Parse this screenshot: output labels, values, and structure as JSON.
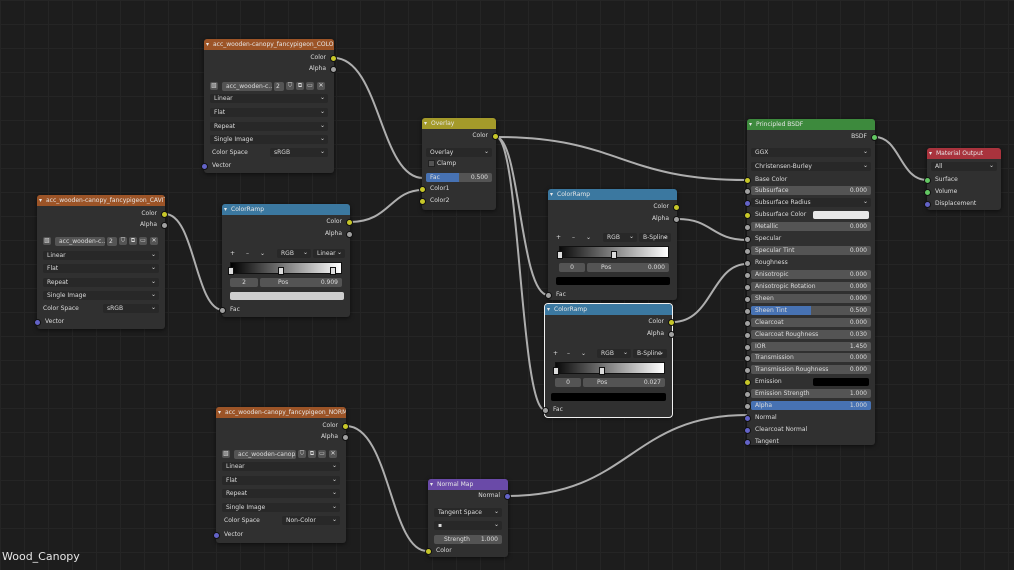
{
  "editor_label": "Wood_Canopy",
  "colors": {
    "texture_header": "#9c5427",
    "converter_header": "#3b78a0",
    "shader_header": "#3d8a3d",
    "output_header": "#a9333d",
    "color_header": "#a49a2a",
    "vector_header": "#6a4aa8",
    "socket_color": "#c7c729",
    "socket_float": "#a1a1a1",
    "socket_vector": "#6363c7",
    "socket_shader": "#63c763"
  },
  "image_nodes": [
    {
      "title": "acc_wooden-canopy_fancypigeon_COLOR",
      "outputs": [
        "Color",
        "Alpha"
      ],
      "image_name": "acc_wooden-c...",
      "users": "2",
      "interpolation": "Linear",
      "projection": "Flat",
      "extension": "Repeat",
      "source": "Single Image",
      "colorspace_label": "Color Space",
      "colorspace": "sRGB",
      "vector": "Vector"
    },
    {
      "title": "acc_wooden-canopy_fancypigeon_CAVITY",
      "outputs": [
        "Color",
        "Alpha"
      ],
      "image_name": "acc_wooden-c...",
      "users": "2",
      "interpolation": "Linear",
      "projection": "Flat",
      "extension": "Repeat",
      "source": "Single Image",
      "colorspace_label": "Color Space",
      "colorspace": "sRGB",
      "vector": "Vector"
    },
    {
      "title": "acc_wooden-canopy_fancypigeon_NORMAL",
      "outputs": [
        "Color",
        "Alpha"
      ],
      "image_name": "acc_wooden-canop...",
      "users": "",
      "interpolation": "Linear",
      "projection": "Flat",
      "extension": "Repeat",
      "source": "Single Image",
      "colorspace_label": "Color Space",
      "colorspace": "Non-Color",
      "vector": "Vector"
    }
  ],
  "color_ramps": [
    {
      "title": "ColorRamp",
      "outputs": [
        "Color",
        "Alpha"
      ],
      "mode": "RGB",
      "interp": "Linear",
      "stop_index": "2",
      "pos_label": "Pos",
      "pos": "0.909",
      "fac": "Fac",
      "stops": [
        0.0,
        0.45,
        0.93
      ]
    },
    {
      "title": "ColorRamp",
      "outputs": [
        "Color",
        "Alpha"
      ],
      "mode": "RGB",
      "interp": "B-Spline",
      "stop_index": "0",
      "pos_label": "Pos",
      "pos": "0.000",
      "fac": "Fac",
      "stops": [
        0.0,
        0.5
      ]
    },
    {
      "title": "ColorRamp",
      "outputs": [
        "Color",
        "Alpha"
      ],
      "mode": "RGB",
      "interp": "B-Spline",
      "stop_index": "0",
      "pos_label": "Pos",
      "pos": "0.027",
      "fac": "Fac",
      "stops": [
        0.0,
        0.43
      ]
    }
  ],
  "overlay": {
    "title": "Overlay",
    "output": "Color",
    "blend": "Overlay",
    "clamp": "Clamp",
    "fac_label": "Fac",
    "fac": "0.500",
    "fac_fraction": 0.5,
    "inputs": [
      "Color1",
      "Color2"
    ]
  },
  "principled": {
    "title": "Principled BSDF",
    "output": "BSDF",
    "distribution": "GGX",
    "subsurface_method": "Christensen-Burley",
    "base_color": "Base Color",
    "params": [
      {
        "label": "Subsurface",
        "value": "0.000"
      },
      {
        "label": "Subsurface Radius",
        "value": ""
      },
      {
        "label": "Subsurface Color",
        "value": ""
      },
      {
        "label": "Metallic",
        "value": "0.000"
      },
      {
        "label": "Specular",
        "value": ""
      },
      {
        "label": "Specular Tint",
        "value": "0.000"
      },
      {
        "label": "Roughness",
        "value": ""
      },
      {
        "label": "Anisotropic",
        "value": "0.000"
      },
      {
        "label": "Anisotropic Rotation",
        "value": "0.000"
      },
      {
        "label": "Sheen",
        "value": "0.000"
      },
      {
        "label": "Sheen Tint",
        "value": "0.500"
      },
      {
        "label": "Clearcoat",
        "value": "0.000"
      },
      {
        "label": "Clearcoat Roughness",
        "value": "0.030"
      },
      {
        "label": "IOR",
        "value": "1.450"
      },
      {
        "label": "Transmission",
        "value": "0.000"
      },
      {
        "label": "Transmission Roughness",
        "value": "0.000"
      },
      {
        "label": "Emission",
        "value": ""
      },
      {
        "label": "Emission Strength",
        "value": "1.000"
      },
      {
        "label": "Alpha",
        "value": "1.000"
      },
      {
        "label": "Normal",
        "value": ""
      },
      {
        "label": "Clearcoat Normal",
        "value": ""
      },
      {
        "label": "Tangent",
        "value": ""
      }
    ],
    "sheen_tint_fraction": 0.5,
    "alpha_fraction": 1.0
  },
  "material_output": {
    "title": "Material Output",
    "target": "All",
    "inputs": [
      "Surface",
      "Volume",
      "Displacement"
    ]
  },
  "normal_map": {
    "title": "Normal Map",
    "output": "Normal",
    "space": "Tangent Space",
    "strength_label": "Strength",
    "strength": "1.000",
    "color": "Color"
  }
}
